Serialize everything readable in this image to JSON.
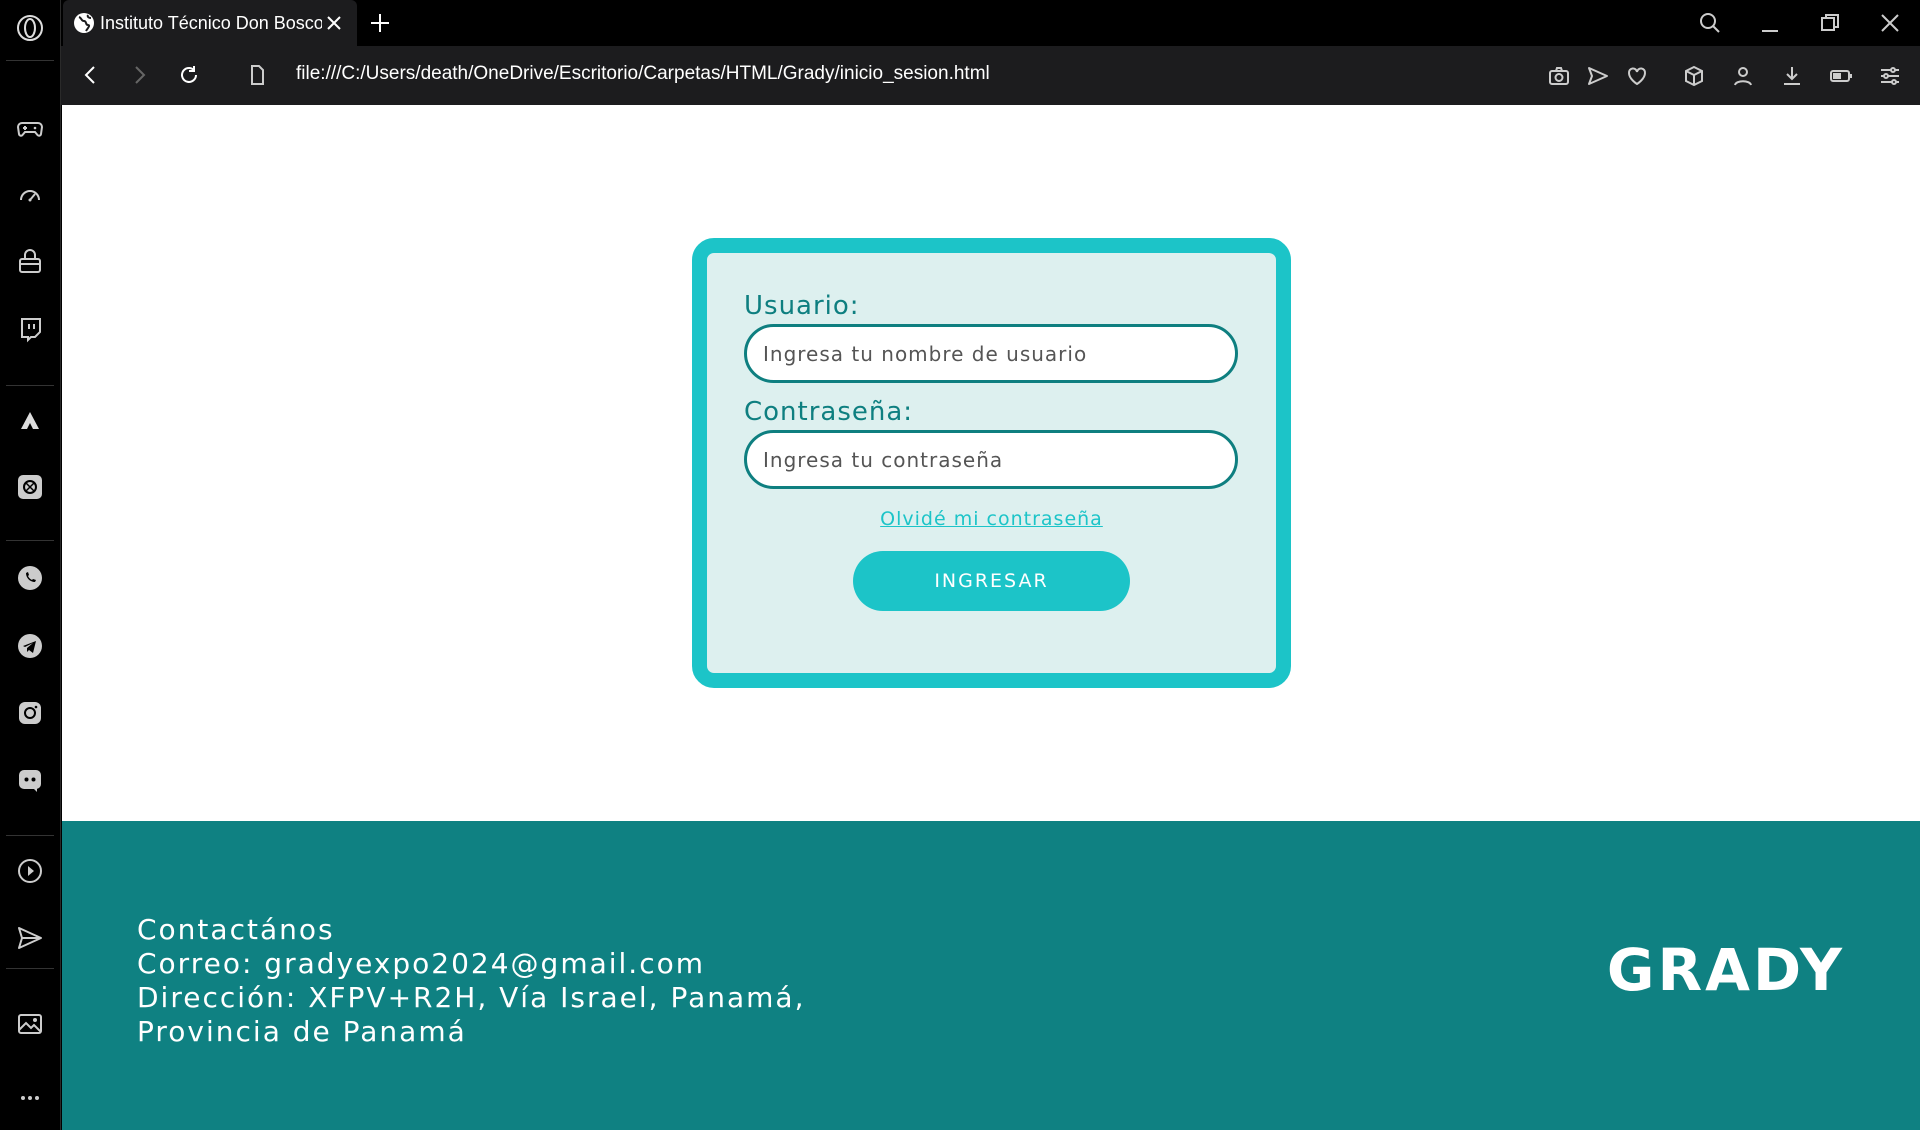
{
  "browser": {
    "tab_title": "Instituto Técnico Don Bosco",
    "url": "file:///C:/Users/death/OneDrive/Escritorio/Carpetas/HTML/Grady/inicio_sesion.html"
  },
  "sidebar": {
    "items": [
      "opera-logo-icon",
      "gamepad-icon",
      "speed-dial-icon",
      "bag-icon",
      "twitch-icon",
      "aria-icon",
      "chatgpt-icon",
      "whatsapp-icon",
      "telegram-icon",
      "instagram-icon",
      "discord-icon",
      "player-icon",
      "send-icon",
      "image-icon",
      "more-icon"
    ]
  },
  "login": {
    "user_label": "Usuario:",
    "user_placeholder": "Ingresa tu nombre de usuario",
    "password_label": "Contraseña:",
    "password_placeholder": "Ingresa tu contraseña",
    "forgot_link": "Olvidé mi contraseña",
    "submit_label": "INGRESAR"
  },
  "footer": {
    "heading": "Contactános",
    "email": "Correo: gradyexpo2024@gmail.com",
    "address": "Dirección: XFPV+R2H, Vía Israel, Panamá, Provincia de Panamá",
    "brand": "GRADY"
  },
  "colors": {
    "accent": "#1cc4c8",
    "dark_teal": "#0e7f80",
    "card_bg": "#ddf0ef",
    "footer_bg": "#0f8182"
  }
}
